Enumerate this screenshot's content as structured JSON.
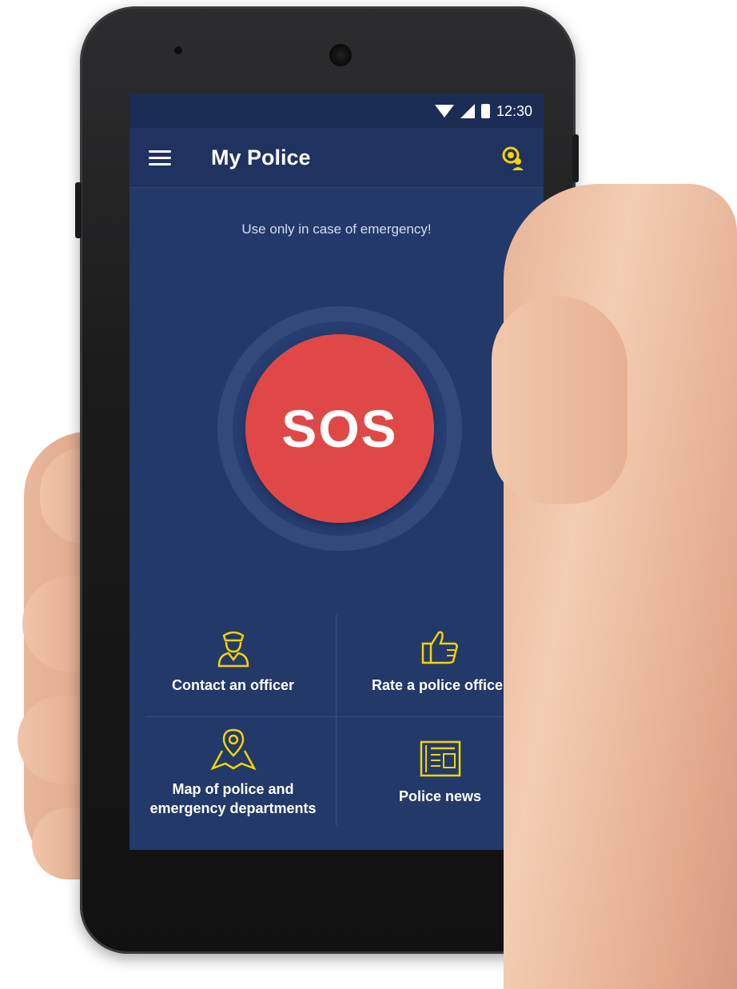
{
  "status_bar": {
    "time": "12:30"
  },
  "app_bar": {
    "title": "My Police"
  },
  "notice": "Use only in case of emergency!",
  "sos": {
    "label": "SOS"
  },
  "menu": [
    {
      "label_lines": [
        "Contact an officer"
      ],
      "icon": "officer-icon"
    },
    {
      "label_lines": [
        "Rate a police officer"
      ],
      "icon": "thumbs-up-icon"
    },
    {
      "label_lines": [
        "Map of police and",
        "emergency departments"
      ],
      "icon": "map-pin-icon"
    },
    {
      "label_lines": [
        "Police news"
      ],
      "icon": "newspaper-icon"
    }
  ],
  "colors": {
    "background": "#22396a",
    "appbar": "#1f3260",
    "sos": "#e04848",
    "accent_yellow": "#f5d400"
  }
}
